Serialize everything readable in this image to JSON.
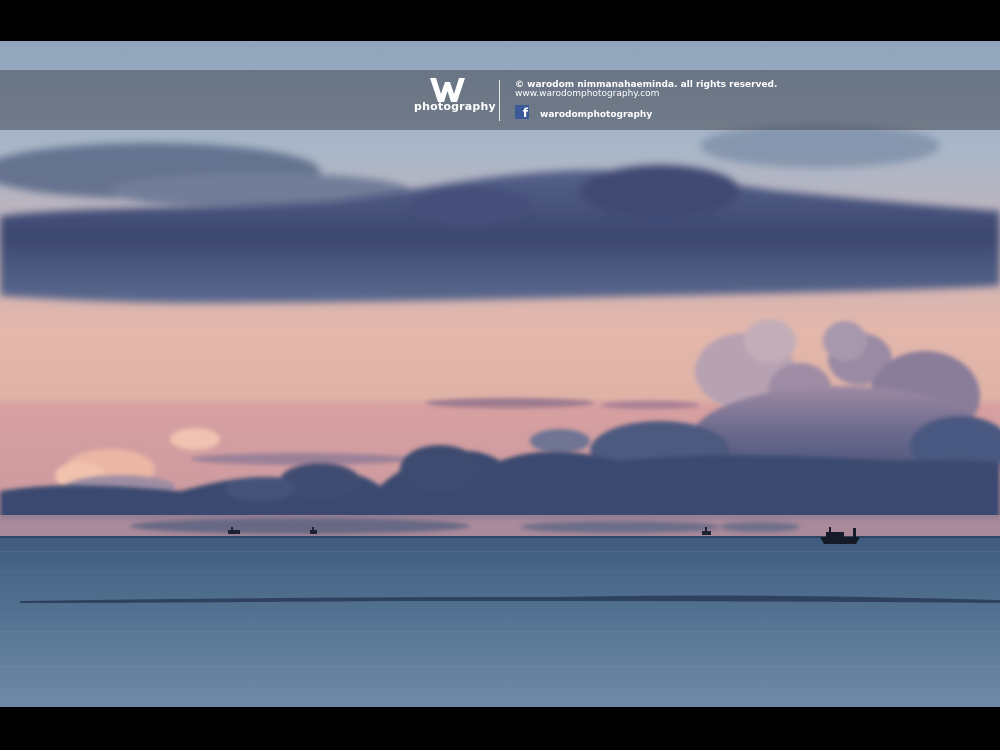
{
  "watermark": {
    "logo_text": "photography",
    "copyright": "© warodom nimmanahaeminda. all rights reserved.",
    "website": "www.warodomphotography.com",
    "facebook_handle": "warodomphotography",
    "facebook_icon": "facebook-icon",
    "logo_icon": "w-logo-icon"
  },
  "scene": {
    "description_colors": {
      "sky_top": "#9fb2c6",
      "sky_mid": "#c4a9b2",
      "sky_horizon": "#e9b3a4",
      "cloud_dark": "#3e4d72",
      "sea": "#4d6b89",
      "facebook_blue": "#3b5998"
    }
  }
}
